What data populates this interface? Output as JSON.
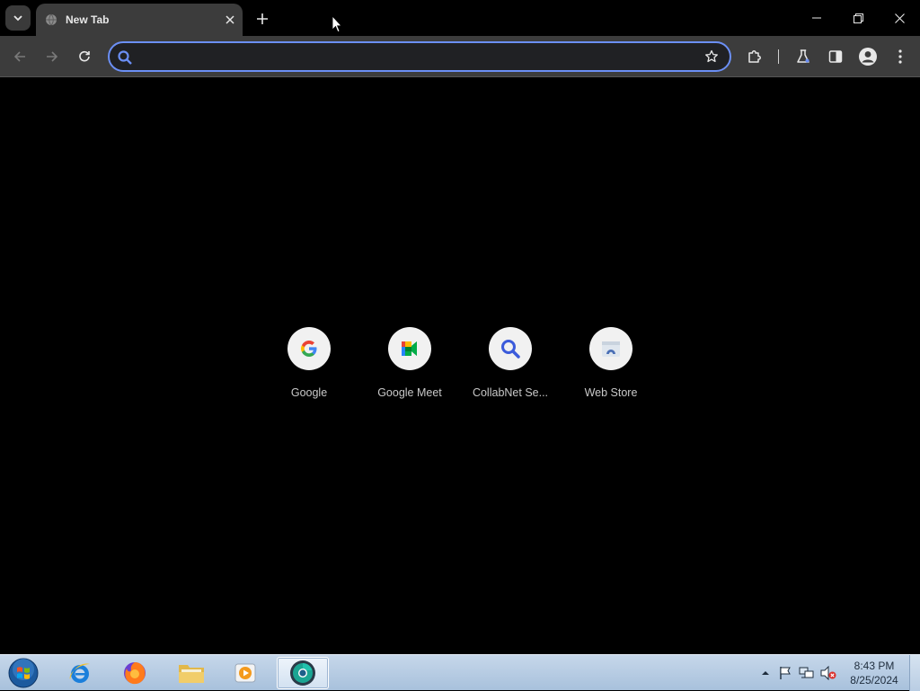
{
  "browser": {
    "tab": {
      "title": "New Tab"
    },
    "omnibox": {
      "value": "",
      "placeholder": ""
    },
    "accent_color": "#6b8ff5"
  },
  "shortcuts": [
    {
      "label": "Google",
      "icon": "google-logo-icon"
    },
    {
      "label": "Google Meet",
      "icon": "google-meet-icon"
    },
    {
      "label": "CollabNet Se...",
      "icon": "search-magnifier-icon"
    },
    {
      "label": "Web Store",
      "icon": "web-store-icon"
    }
  ],
  "taskbar": {
    "apps": [
      "internet-explorer-icon",
      "firefox-icon",
      "file-explorer-icon",
      "media-player-icon",
      "chrome-dev-icon"
    ],
    "clock": {
      "time": "8:43 PM",
      "date": "8/25/2024"
    }
  }
}
